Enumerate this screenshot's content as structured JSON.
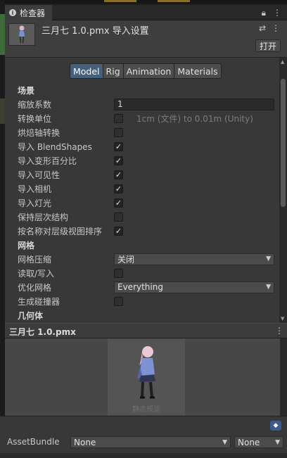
{
  "window": {
    "tab_label": "检查器",
    "tab_lock_icon": "lock-icon",
    "tab_menu_icon": "more-vert-icon"
  },
  "header": {
    "title": "三月七 1.0.pmx 导入设置",
    "open_button": "打开",
    "settings_icon": "sliders-icon",
    "menu_icon": "more-vert-icon"
  },
  "tabs": [
    "Model",
    "Rig",
    "Animation",
    "Materials"
  ],
  "active_tab": "Model",
  "settings": {
    "scene_header": "场景",
    "scale_factor_label": "缩放系数",
    "scale_factor_value": "1",
    "convert_units_label": "转换单位",
    "convert_units_text": "1cm (文件) to 0.01m (Unity)",
    "bake_axis_label": "烘焙轴转换",
    "import_blendshapes_label": "导入 BlendShapes",
    "import_deform_percent_label": "导入变形百分比",
    "import_visibility_label": "导入可见性",
    "import_cameras_label": "导入相机",
    "import_lights_label": "导入灯光",
    "preserve_hierarchy_label": "保持层次结构",
    "sort_hierarchy_label": "按名称对层级视图排序",
    "mesh_header": "网格",
    "mesh_compression_label": "网格压缩",
    "mesh_compression_value": "关闭",
    "read_write_label": "读取/写入",
    "optimize_mesh_label": "优化网格",
    "optimize_mesh_value": "Everything",
    "generate_colliders_label": "生成碰撞器",
    "geometry_header": "几何体"
  },
  "checkboxes": {
    "convert_units": false,
    "bake_axis": false,
    "import_blendshapes": true,
    "import_deform_percent": true,
    "import_visibility": true,
    "import_cameras": true,
    "import_lights": true,
    "preserve_hierarchy": false,
    "sort_hierarchy": true,
    "read_write": false,
    "generate_colliders": false
  },
  "preview": {
    "title": "三月七 1.0.pmx",
    "static_label": "静态预览"
  },
  "asset_bundle": {
    "label": "AssetBundle",
    "name_value": "None",
    "variant_value": "None"
  },
  "colors": {
    "active_tab": "#46607c",
    "panel_bg": "#383838",
    "tag_icon": "#3c5c8c"
  }
}
